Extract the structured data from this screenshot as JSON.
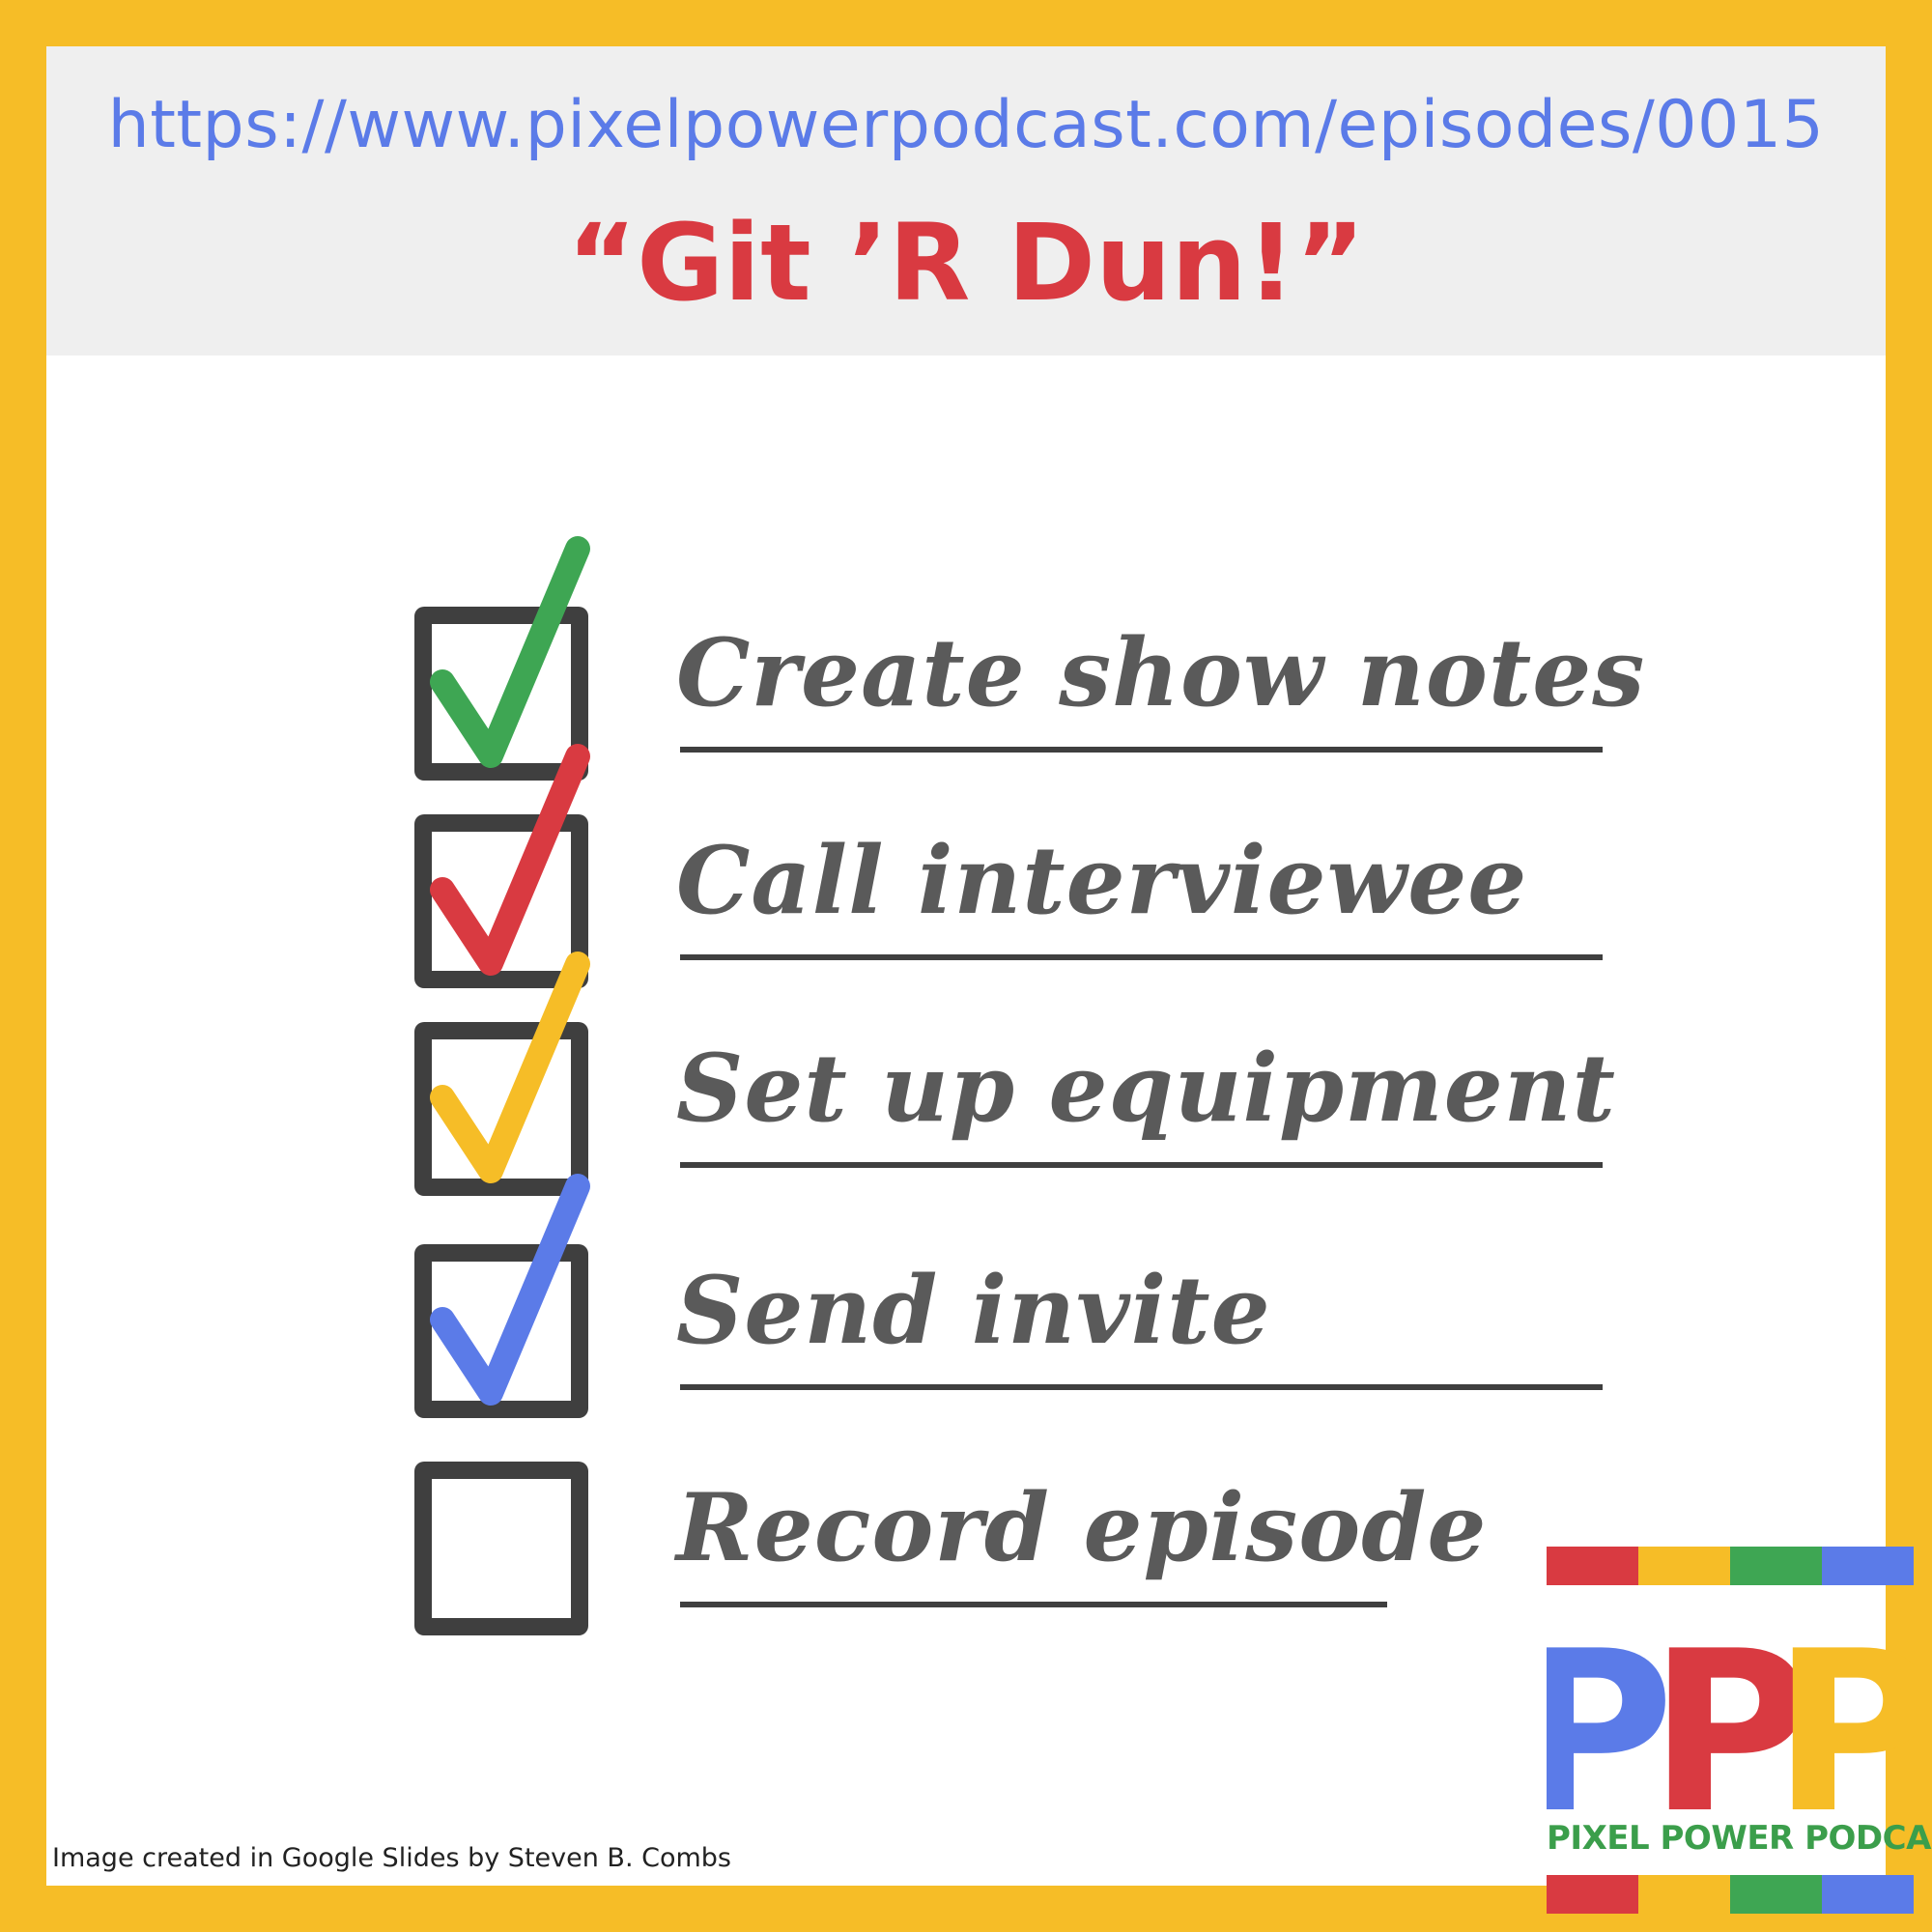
{
  "header": {
    "url": "https://www.pixelpowerpodcast.com/episodes/0015",
    "title": "“Git ’R Dun!”"
  },
  "checklist": {
    "items": [
      {
        "label": "Create show notes",
        "checked": true,
        "check_color": "#3ea653"
      },
      {
        "label": "Call interviewee",
        "checked": true,
        "check_color": "#d93a41"
      },
      {
        "label": "Set up equipment",
        "checked": true,
        "check_color": "#f6bd27"
      },
      {
        "label": "Send invite",
        "checked": true,
        "check_color": "#5b7be8"
      },
      {
        "label": "Record episode",
        "checked": false,
        "check_color": ""
      }
    ]
  },
  "logo": {
    "letters": "PPP",
    "name": "PIXEL POWER PODCAST",
    "colors": [
      "#d93a41",
      "#f6bd27",
      "#3ea653",
      "#5b7be8"
    ]
  },
  "credit": "Image created in Google Slides by Steven B. Combs",
  "colors": {
    "border": "#f6bd27",
    "header_bg": "#efefef",
    "url": "#5b7be8",
    "title": "#d93a41",
    "text": "#5a5a5a",
    "box": "#3f3f3f"
  }
}
